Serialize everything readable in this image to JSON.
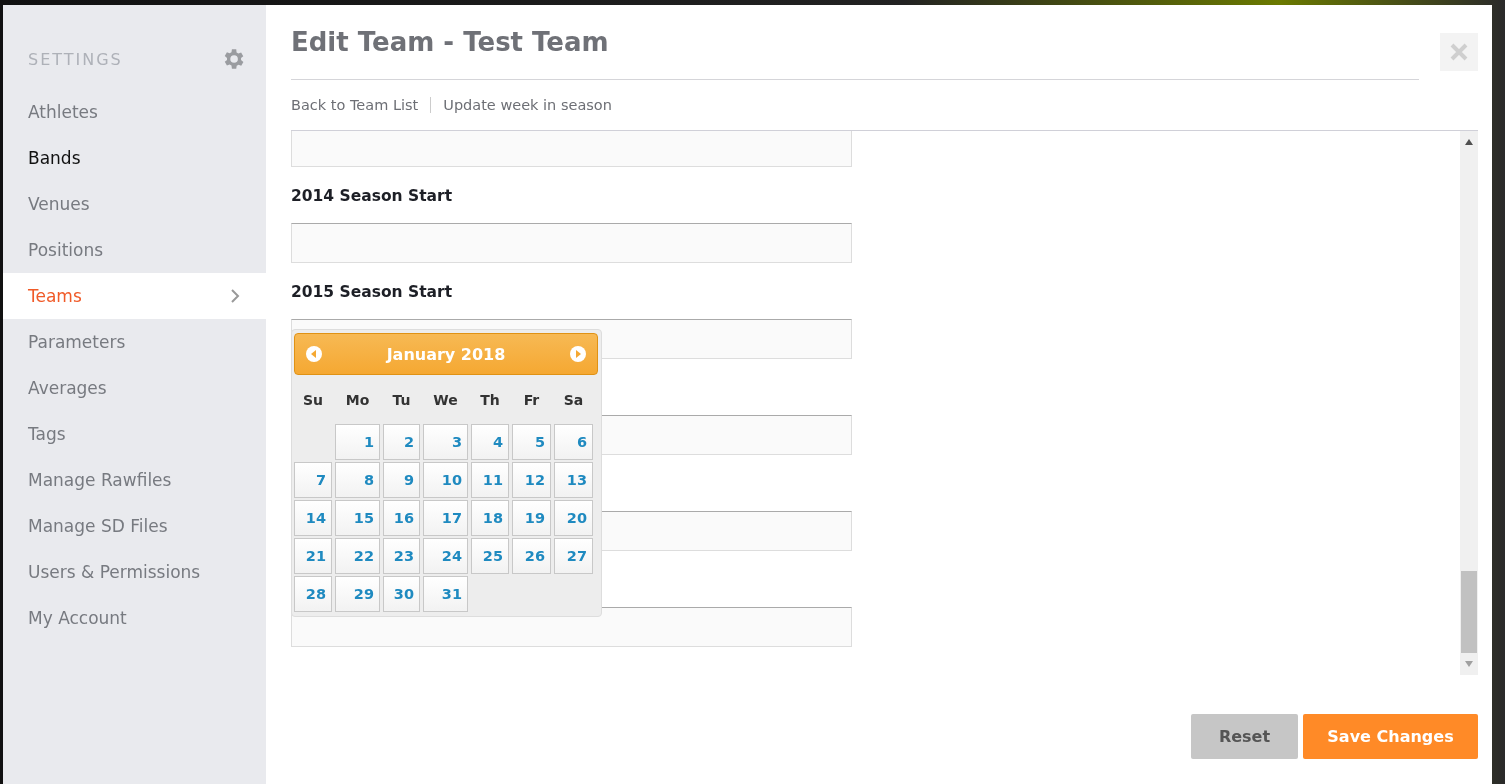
{
  "sidebar": {
    "title": "SETTINGS",
    "items": [
      {
        "label": "Athletes",
        "selected": false,
        "hovered": false
      },
      {
        "label": "Bands",
        "selected": false,
        "hovered": true
      },
      {
        "label": "Venues",
        "selected": false,
        "hovered": false
      },
      {
        "label": "Positions",
        "selected": false,
        "hovered": false
      },
      {
        "label": "Teams",
        "selected": true,
        "hovered": false
      },
      {
        "label": "Parameters",
        "selected": false,
        "hovered": false
      },
      {
        "label": "Averages",
        "selected": false,
        "hovered": false
      },
      {
        "label": "Tags",
        "selected": false,
        "hovered": false
      },
      {
        "label": "Manage Rawfiles",
        "selected": false,
        "hovered": false
      },
      {
        "label": "Manage SD Files",
        "selected": false,
        "hovered": false
      },
      {
        "label": "Users & Permissions",
        "selected": false,
        "hovered": false
      },
      {
        "label": "My Account",
        "selected": false,
        "hovered": false
      }
    ]
  },
  "dialog": {
    "title": "Edit Team - Test Team",
    "links": [
      "Back to Team List",
      "Update week in season"
    ]
  },
  "form": [
    {
      "kind": "field",
      "cut": true
    },
    {
      "kind": "label",
      "text": "2014 Season Start"
    },
    {
      "kind": "field",
      "cut": false
    },
    {
      "kind": "label",
      "text": "2015 Season Start"
    },
    {
      "kind": "field",
      "cut": false
    },
    {
      "kind": "hidden-label"
    },
    {
      "kind": "field",
      "cut": false
    },
    {
      "kind": "hidden-label"
    },
    {
      "kind": "field",
      "cut": false
    },
    {
      "kind": "hidden-label"
    },
    {
      "kind": "field",
      "cut": false
    }
  ],
  "datepicker": {
    "month": "January 2018",
    "weekdays": [
      "Su",
      "Mo",
      "Tu",
      "We",
      "Th",
      "Fr",
      "Sa"
    ],
    "weeks": [
      {
        "kind": "first",
        "days": [
          "1",
          "2",
          "3",
          "4",
          "5",
          "6"
        ]
      },
      {
        "kind": "week",
        "days": [
          "7",
          "8",
          "9",
          "10",
          "11",
          "12",
          "13"
        ]
      },
      {
        "kind": "week",
        "days": [
          "14",
          "15",
          "16",
          "17",
          "18",
          "19",
          "20"
        ]
      },
      {
        "kind": "week",
        "days": [
          "21",
          "22",
          "23",
          "24",
          "25",
          "26",
          "27"
        ]
      },
      {
        "kind": "week",
        "days": [
          "28",
          "29",
          "30",
          "31"
        ]
      }
    ]
  },
  "buttons": [
    {
      "label": "Reset",
      "kind": "secondary"
    },
    {
      "label": "Save Changes",
      "kind": "primary"
    }
  ]
}
